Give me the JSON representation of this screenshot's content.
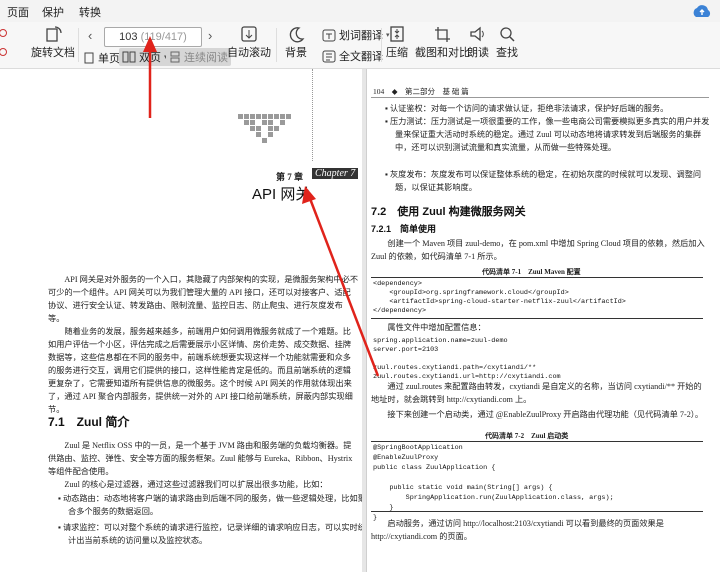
{
  "menu": [
    "页面",
    "保护",
    "转换"
  ],
  "toolbar": {
    "rotate_label": "旋转文档",
    "single_label": "单页",
    "dual_label": "双页",
    "continuous_label": "连续阅读",
    "autoscroll_label": "自动滚动",
    "background_label": "背景",
    "translate_label": "划词翻译",
    "fulltext_translate_label": "全文翻译",
    "compress_label": "压缩",
    "screenshot_label": "截图和对比",
    "read_label": "朗读",
    "search_label": "查找",
    "page_current": "103",
    "page_total": "(119/417)"
  },
  "left_page": {
    "chapter_label": "第 7 章",
    "chapter_en": "Chapter 7",
    "chapter_title": "API 网关",
    "paragraphs": [
      "API 网关是对外服务的一个入口，其隐藏了内部架构的实现，是微服务架构中必不可少的一个组件。API 网关可以为我们管理大量的 API 接口，还可以对接客户、适配协议、进行安全认证、转发路由、限制流量、监控日志、防止爬虫、进行灰度发布等。",
      "随着业务的发展，服务越来越多，前端用户如何调用微服务就成了一个难题。比如用户评估一个小区，评估完成之后需要展示小区详情、房价走势、成交数据、挂牌数据等，这些信息都在不同的服务中，前端系统想要实现这样一个功能就需要和众多的服务进行交互，调用它们提供的接口，这样性能肯定是低的。而且前端系统的逻辑更复杂了，它需要知道所有提供信息的微服务。这个时候 API 网关的作用就体现出来了，通过 API 聚合内部服务，提供统一对外的 API 接口给前端系统，屏蔽内部实现细节。"
    ],
    "section_title": "7.1　Zuul 简介",
    "section_paragraphs": [
      "Zuul 是 Netflix OSS 中的一员，是一个基于 JVM 路由和服务端的负载均衡器。提供路由、监控、弹性、安全等方面的服务框架。Zuul 能够与 Eureka、Ribbon、Hystrix 等组件配合使用。",
      "Zuul 的核心是过滤器，通过这些过滤器我们可以扩展出很多功能，比如："
    ],
    "bullets": [
      "动态路由：动态地将客户端的请求路由到后端不同的服务，做一些逻辑处理，比如聚合多个服务的数据返回。",
      "请求监控：可以对整个系统的请求进行监控，记录详细的请求响应日志，可以实时统计出当前系统的访问量以及监控状态。"
    ]
  },
  "right_page": {
    "header": "104　◆　第二部分　基 础 篇",
    "bullets": [
      "认证鉴权：对每一个访问的请求做认证，拒绝非法请求，保护好后端的服务。",
      "压力测试：压力测试是一项很重要的工作，像一些电商公司需要模拟更多真实的用户并发量来保证重大活动时系统的稳定。通过 Zuul 可以动态地将请求转发到后端服务的集群中，还可以识别测试流量和真实流量，从而做一些特殊处理。",
      "灰度发布：灰度发布可以保证整体系统的稳定，在初始灰度的时候就可以发现、调整问题，以保证其影响度。"
    ],
    "section_title": "7.2　使用 Zuul 构建微服务网关",
    "subsection_title": "7.2.1　简单使用",
    "intro": "创建一个 Maven 项目 zuul-demo，在 pom.xml 中增加 Spring Cloud 项目的依赖，然后加入 Zuul 的依赖，如代码清单 7-1 所示。",
    "listing1_caption": "代码清单 7-1　Zuul Maven 配置",
    "listing1": "<dependency>\n    <groupId>org.springframework.cloud</groupId>\n    <artifactId>spring-cloud-starter-netflix-zuul</artifactId>\n</dependency>",
    "config_label": "属性文件中增加配置信息：",
    "config_code": "spring.application.name=zuul-demo\nserver.port=2103\n\nzuul.routes.cxytiandi.path=/cxytiandi/**\nzuul.routes.cxytiandi.url=http://cxytiandi.com",
    "para_routes": "通过 zuul.routes 来配置路由转发，cxytiandi 是自定义的名称，当访问 cxytiandi/** 开始的地址时，就会跳转到 http://cxytiandi.com 上。",
    "para_next": "接下来创建一个启动类，通过 @EnableZuulProxy 开启路由代理功能（见代码清单 7-2）。",
    "listing2_caption": "代码清单 7-2　Zuul 启动类",
    "listing2": "@SpringBootApplication\n@EnableZuulProxy\npublic class ZuulApplication {\n\n    public static void main(String[] args) {\n        SpringApplication.run(ZuulApplication.class, args);\n    }\n}",
    "para_end": "启动服务，通过访问 http://localhost:2103/cxytiandi 可以看到最终的页面效果是 http://cxytiandi.com 的页面。"
  }
}
